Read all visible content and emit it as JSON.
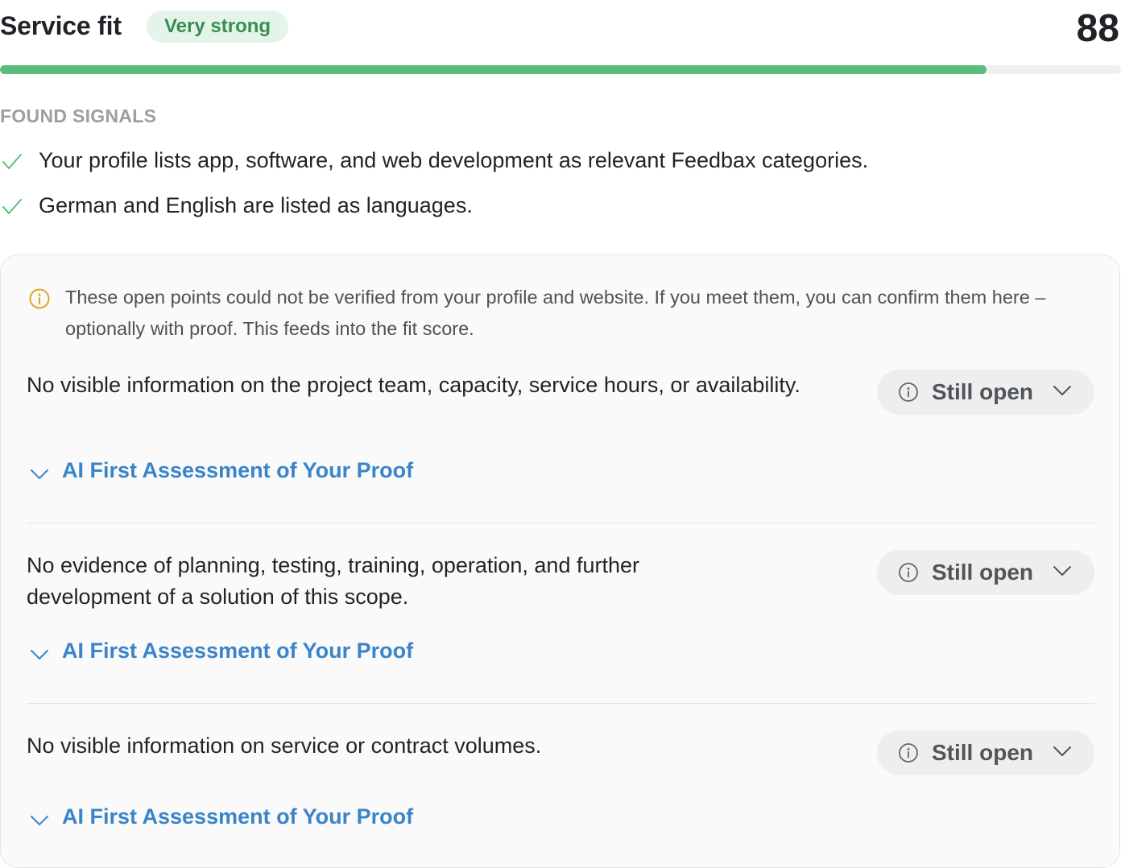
{
  "header": {
    "title": "Service fit",
    "badge": "Very strong",
    "score": "88",
    "progress": 0.88
  },
  "found_signals": {
    "label": "FOUND SIGNALS",
    "items": [
      {
        "icon": "check-icon",
        "text": "Your profile lists app, software, and web development as relevant Feedbax categories."
      },
      {
        "icon": "check-icon",
        "text": "German and English are listed as languages."
      }
    ]
  },
  "open_points": {
    "note": "These open points could not be verified from your profile and website. If you meet them, you can confirm them here – optionally with proof. This feeds into the fit score.",
    "items": [
      {
        "text": "No visible information on the project team, capacity, service hours, or availability.",
        "status": "Still open",
        "assessment": "AI First Assessment of Your Proof"
      },
      {
        "text": "No evidence of planning, testing, training, operation, and further development of a solution of this scope.",
        "status": "Still open",
        "assessment": "AI First Assessment of Your Proof"
      },
      {
        "text": "No visible information on service or contract volumes.",
        "status": "Still open",
        "assessment": "AI First Assessment of Your Proof"
      }
    ]
  },
  "colors": {
    "accent_green": "#5bbd7b",
    "badge_bg": "#e3f5e8",
    "badge_text": "#3b8c52",
    "link_blue": "#3a84c9",
    "warning_amber": "#e0a526"
  }
}
